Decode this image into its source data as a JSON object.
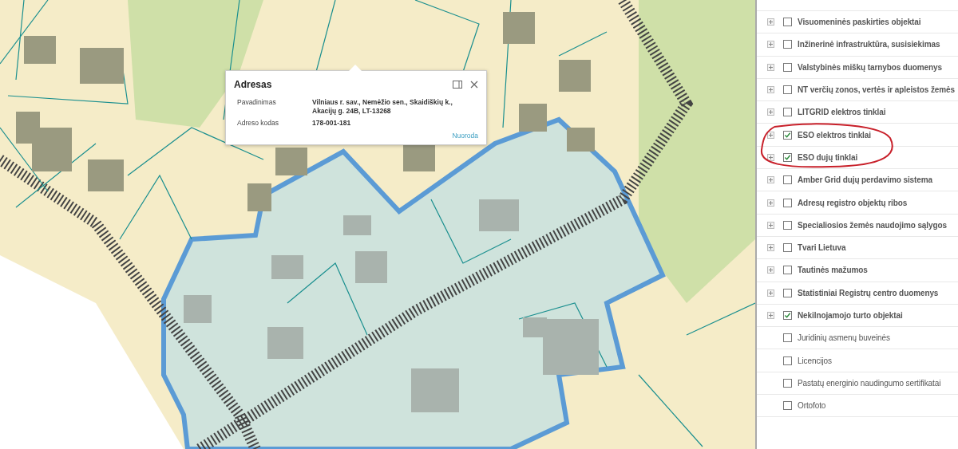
{
  "popup": {
    "title": "Adresas",
    "fields": [
      {
        "label": "Pavadinimas",
        "value": "Vilniaus r. sav., Nemėžio sen., Skaidiškių k., Akacijų g. 24B, LT-13268"
      },
      {
        "label": "Adreso kodas",
        "value": "178-001-181"
      }
    ],
    "link": "Nuoroda"
  },
  "layers": {
    "items": [
      {
        "kind": "group",
        "label": "Visuomeninės paskirties objektai",
        "checked": false
      },
      {
        "kind": "group",
        "label": "Inžinerinė infrastruktūra, susisiekimas",
        "checked": false
      },
      {
        "kind": "group",
        "label": "Valstybinės miškų tarnybos duomenys",
        "checked": false
      },
      {
        "kind": "group",
        "label": "NT verčių zonos, vertės ir apleistos žemės",
        "checked": false
      },
      {
        "kind": "group",
        "label": "LITGRID elektros tinklai",
        "checked": false
      },
      {
        "kind": "group",
        "label": "ESO elektros tinklai",
        "checked": true
      },
      {
        "kind": "group",
        "label": "ESO dujų tinklai",
        "checked": true
      },
      {
        "kind": "group",
        "label": "Amber Grid dujų perdavimo sistema",
        "checked": false
      },
      {
        "kind": "group",
        "label": "Adresų registro objektų ribos",
        "checked": false
      },
      {
        "kind": "group",
        "label": "Specialiosios žemės naudojimo sąlygos",
        "checked": false
      },
      {
        "kind": "group",
        "label": "Tvari Lietuva",
        "checked": false
      },
      {
        "kind": "group",
        "label": "Tautinės mažumos",
        "checked": false
      },
      {
        "kind": "group",
        "label": "Statistiniai Registrų centro duomenys",
        "checked": false
      },
      {
        "kind": "group",
        "label": "Nekilnojamojo turto objektai",
        "checked": true
      },
      {
        "kind": "layer",
        "label": "Juridinių asmenų buveinės",
        "checked": false
      },
      {
        "kind": "layer",
        "label": "Licencijos",
        "checked": false
      },
      {
        "kind": "layer",
        "label": "Pastatų energinio naudingumo sertifikatai",
        "checked": false
      },
      {
        "kind": "layer",
        "label": "Ortofoto",
        "checked": false
      }
    ]
  }
}
